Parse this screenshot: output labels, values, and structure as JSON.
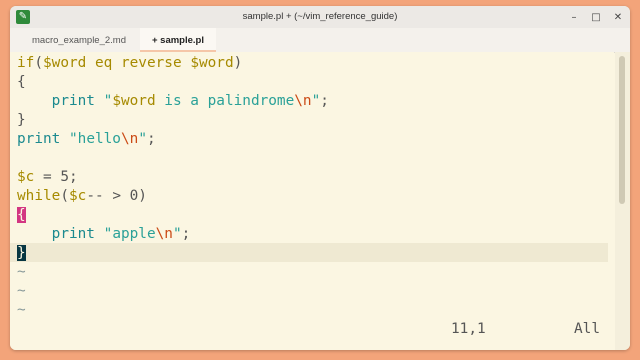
{
  "window": {
    "title": "sample.pl + (~/vim_reference_guide)",
    "app_icon_glyph": "✎",
    "controls": {
      "minimize": "–",
      "maximize": "□",
      "close": "✕"
    }
  },
  "tabs": [
    {
      "label": "macro_example_2.md",
      "active": false
    },
    {
      "label": "+ sample.pl",
      "active": true
    }
  ],
  "code": {
    "l1": {
      "kw": "if",
      "open": "(",
      "v1": "$word",
      "eq": " eq ",
      "rev": "reverse",
      "sp": " ",
      "v2": "$word",
      "close": ")"
    },
    "l2": {
      "text": "{"
    },
    "l3": {
      "indent": "    ",
      "print": "print",
      "q1": " \"",
      "v": "$word",
      "s": " is a palindrome",
      "esc": "\\n",
      "q2": "\"",
      "semi": ";"
    },
    "l4": {
      "text": "}"
    },
    "l5": {
      "print": "print",
      "q1": " \"",
      "s": "hello",
      "esc": "\\n",
      "q2": "\"",
      "semi": ";"
    },
    "l7": {
      "v": "$c",
      "op": " = 5;"
    },
    "l8": {
      "kw": "while",
      "open": "(",
      "v": "$c",
      "op": "-- > 0)"
    },
    "l9": {
      "text": "{"
    },
    "l10": {
      "indent": "    ",
      "print": "print",
      "q1": " \"",
      "s": "apple",
      "esc": "\\n",
      "q2": "\"",
      "semi": ";"
    },
    "l11": {
      "text": "}"
    },
    "tilde": "~"
  },
  "status": {
    "position": "11,1",
    "scroll": "All"
  },
  "colors": {
    "background": "#f3a47a",
    "editor_bg": "#fbf6e2",
    "keyword": "#a68a00",
    "string": "#2aa198",
    "escape": "#cb4b16",
    "match_brace": "#d33682"
  }
}
